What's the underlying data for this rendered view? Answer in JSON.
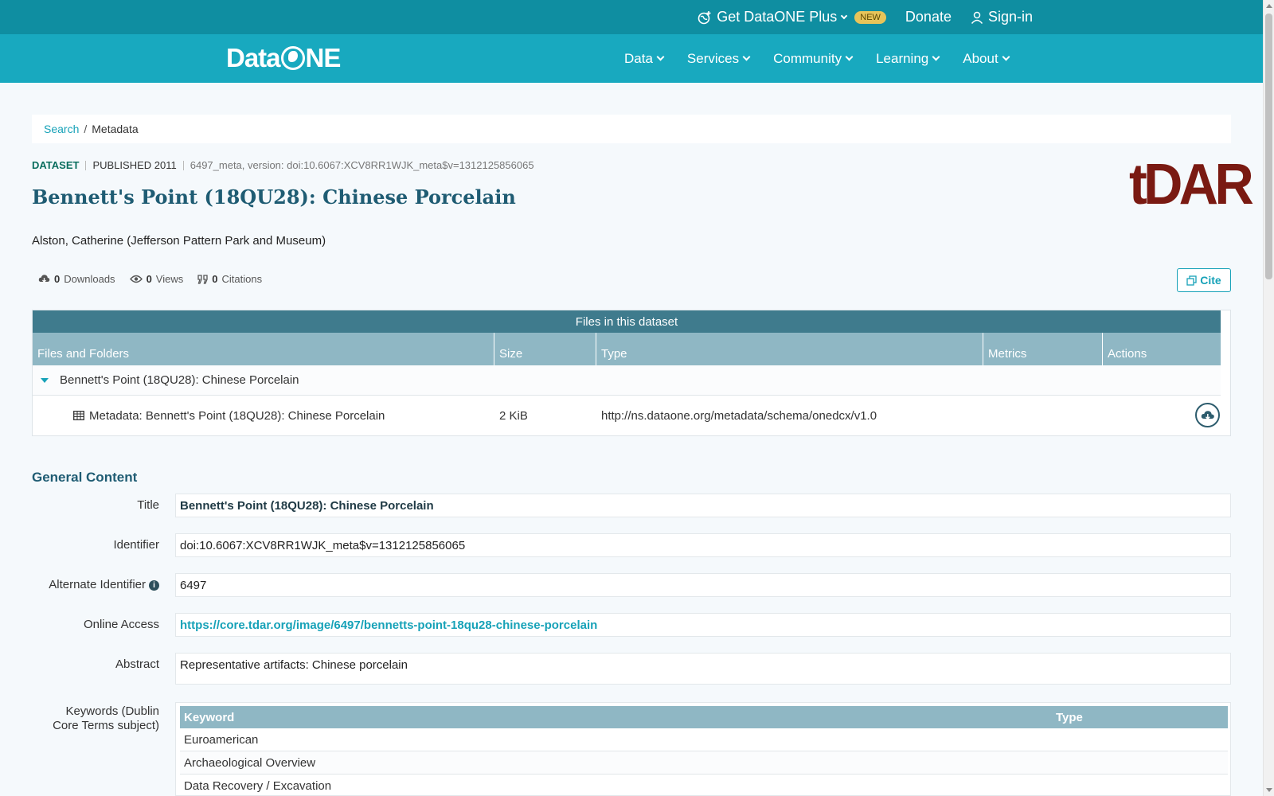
{
  "topbar": {
    "plus_label": "Get DataONE Plus",
    "new_badge": "NEW",
    "donate_label": "Donate",
    "signin_label": "Sign-in"
  },
  "nav": {
    "logo_text_left": "Data",
    "logo_text_right": "NE",
    "items": [
      "Data",
      "Services",
      "Community",
      "Learning",
      "About"
    ]
  },
  "breadcrumb": {
    "search": "Search",
    "separator": "/",
    "current": "Metadata"
  },
  "dataset": {
    "type_label": "DATASET",
    "published": "PUBLISHED 2011",
    "version": "6497_meta, version: doi:10.6067:XCV8RR1WJK_meta$v=1312125856065",
    "title": "Bennett's Point (18QU28): Chinese Porcelain",
    "author": "Alston, Catherine (Jefferson Pattern Park and Museum)",
    "repo_logo": "tDAR",
    "metrics": {
      "downloads_count": "0",
      "downloads_label": "Downloads",
      "views_count": "0",
      "views_label": "Views",
      "citations_count": "0",
      "citations_label": "Citations"
    },
    "cite_label": "Cite"
  },
  "files": {
    "caption": "Files in this dataset",
    "columns": [
      "Files and Folders",
      "Size",
      "Type",
      "Metrics",
      "Actions"
    ],
    "folder": "Bennett's Point (18QU28): Chinese Porcelain",
    "file": {
      "name": "Metadata: Bennett's Point (18QU28): Chinese Porcelain",
      "size": "2 KiB",
      "type": "http://ns.dataone.org/metadata/schema/onedcx/v1.0"
    }
  },
  "general": {
    "section_title": "General Content",
    "title_label": "Title",
    "title_value": "Bennett's Point (18QU28): Chinese Porcelain",
    "identifier_label": "Identifier",
    "identifier_value": "doi:10.6067:XCV8RR1WJK_meta$v=1312125856065",
    "alt_identifier_label": "Alternate Identifier",
    "alt_identifier_value": "6497",
    "online_access_label": "Online Access",
    "online_access_value": "https://core.tdar.org/image/6497/bennetts-point-18qu28-chinese-porcelain",
    "abstract_label": "Abstract",
    "abstract_value": "Representative artifacts: Chinese porcelain",
    "keywords_label_1": "Keywords (Dublin",
    "keywords_label_2": "Core Terms subject)",
    "keywords_columns": [
      "Keyword",
      "Type"
    ],
    "keywords": [
      "Euroamerican",
      "Archaeological Overview",
      "Data Recovery / Excavation"
    ]
  },
  "colors": {
    "topbar": "#0f8ea1",
    "navbar": "#18a9bf",
    "title": "#1f5c73",
    "accent": "#17a2b8",
    "table_head": "#8fb7c4",
    "caption": "#3f7b8d",
    "tdar": "#7a1a12"
  }
}
